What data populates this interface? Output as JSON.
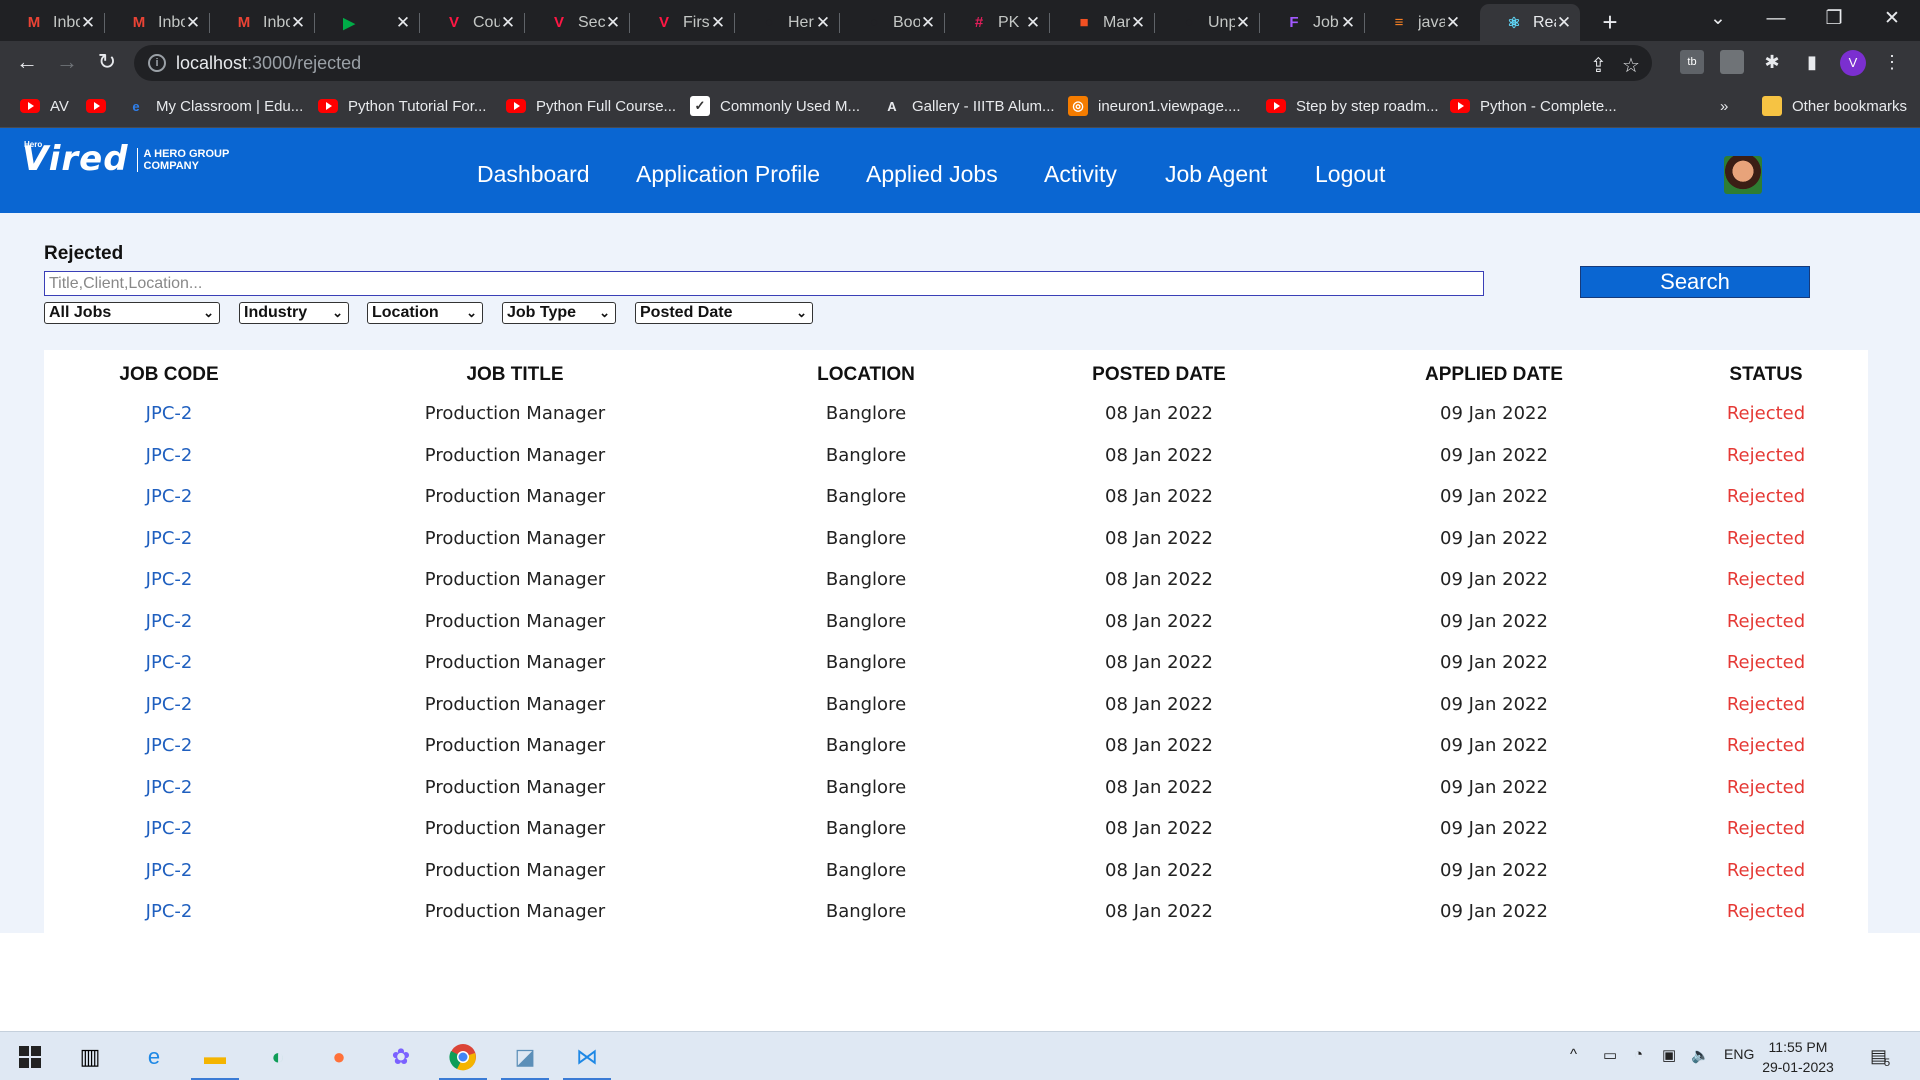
{
  "browser": {
    "tabs": [
      {
        "title": "Inbox",
        "icon": "gmail-icon",
        "color": "#ea4335",
        "glyph": "M"
      },
      {
        "title": "Inbox",
        "icon": "gmail-icon",
        "color": "#ea4335",
        "glyph": "M"
      },
      {
        "title": "Inbox",
        "icon": "gmail-icon",
        "color": "#ea4335",
        "glyph": "M"
      },
      {
        "title": "",
        "icon": "meet-icon",
        "color": "#00ac47",
        "glyph": "▶"
      },
      {
        "title": "Cou",
        "icon": "vired-icon",
        "color": "#ff1744",
        "glyph": "V"
      },
      {
        "title": "Sec",
        "icon": "vired-icon",
        "color": "#ff1744",
        "glyph": "V"
      },
      {
        "title": "First",
        "icon": "vired-icon",
        "color": "#ff1744",
        "glyph": "V"
      },
      {
        "title": "Her",
        "icon": "github-icon",
        "color": "#202124",
        "glyph": "○"
      },
      {
        "title": "Boo",
        "icon": "github-icon",
        "color": "#202124",
        "glyph": "○"
      },
      {
        "title": "PK",
        "icon": "slack-icon",
        "color": "#e01e5a",
        "glyph": "#"
      },
      {
        "title": "Mar",
        "icon": "microsoft-icon",
        "color": "#f25022",
        "glyph": "■"
      },
      {
        "title": "Unp",
        "icon": "github-icon",
        "color": "#202124",
        "glyph": "○"
      },
      {
        "title": "Job",
        "icon": "figma-icon",
        "color": "#a259ff",
        "glyph": "F"
      },
      {
        "title": "java",
        "icon": "stackoverflow-icon",
        "color": "#f48024",
        "glyph": "≡"
      },
      {
        "title": "Rea",
        "icon": "react-icon",
        "color": "#61dafb",
        "glyph": "⚛"
      }
    ],
    "url_host": "localhost",
    "url_path": ":3000/rejected",
    "profile_initial": "V",
    "bookmarks": [
      {
        "label": "AV",
        "type": "yt"
      },
      {
        "label": "",
        "type": "yt"
      },
      {
        "label": "My Classroom | Edu...",
        "type": "edu"
      },
      {
        "label": "Python Tutorial For...",
        "type": "yt"
      },
      {
        "label": "Python Full Course...",
        "type": "yt"
      },
      {
        "label": "Commonly Used M...",
        "type": "doc"
      },
      {
        "label": "Gallery - IIITB Alum...",
        "type": "alum"
      },
      {
        "label": "ineuron1.viewpage....",
        "type": "ineuron"
      },
      {
        "label": "Step by step roadm...",
        "type": "yt"
      },
      {
        "label": "Python - Complete...",
        "type": "yt"
      }
    ],
    "more_bookmarks": "»",
    "other_bookmarks": "Other bookmarks"
  },
  "app": {
    "logo_hero": "Hero",
    "logo_brand": "Vired",
    "logo_tag_line1": "A HERO GROUP",
    "logo_tag_line2": "COMPANY",
    "nav": [
      "Dashboard",
      "Application Profile",
      "Applied Jobs",
      "Activity",
      "Job Agent",
      "Logout"
    ]
  },
  "page": {
    "title": "Rejected",
    "search_placeholder": "Title,Client,Location...",
    "search_button": "Search",
    "filters": [
      "All Jobs",
      "Industry",
      "Location",
      "Job Type",
      "Posted Date"
    ]
  },
  "table": {
    "headers": [
      "JOB CODE",
      "JOB TITLE",
      "LOCATION",
      "POSTED DATE",
      "APPLIED DATE",
      "STATUS"
    ],
    "rows": [
      [
        "JPC-2",
        "Production Manager",
        "Banglore",
        "08 Jan 2022",
        "09 Jan 2022",
        "Rejected"
      ],
      [
        "JPC-2",
        "Production Manager",
        "Banglore",
        "08 Jan 2022",
        "09 Jan 2022",
        "Rejected"
      ],
      [
        "JPC-2",
        "Production Manager",
        "Banglore",
        "08 Jan 2022",
        "09 Jan 2022",
        "Rejected"
      ],
      [
        "JPC-2",
        "Production Manager",
        "Banglore",
        "08 Jan 2022",
        "09 Jan 2022",
        "Rejected"
      ],
      [
        "JPC-2",
        "Production Manager",
        "Banglore",
        "08 Jan 2022",
        "09 Jan 2022",
        "Rejected"
      ],
      [
        "JPC-2",
        "Production Manager",
        "Banglore",
        "08 Jan 2022",
        "09 Jan 2022",
        "Rejected"
      ],
      [
        "JPC-2",
        "Production Manager",
        "Banglore",
        "08 Jan 2022",
        "09 Jan 2022",
        "Rejected"
      ],
      [
        "JPC-2",
        "Production Manager",
        "Banglore",
        "08 Jan 2022",
        "09 Jan 2022",
        "Rejected"
      ],
      [
        "JPC-2",
        "Production Manager",
        "Banglore",
        "08 Jan 2022",
        "09 Jan 2022",
        "Rejected"
      ],
      [
        "JPC-2",
        "Production Manager",
        "Banglore",
        "08 Jan 2022",
        "09 Jan 2022",
        "Rejected"
      ],
      [
        "JPC-2",
        "Production Manager",
        "Banglore",
        "08 Jan 2022",
        "09 Jan 2022",
        "Rejected"
      ],
      [
        "JPC-2",
        "Production Manager",
        "Banglore",
        "08 Jan 2022",
        "09 Jan 2022",
        "Rejected"
      ],
      [
        "JPC-2",
        "Production Manager",
        "Banglore",
        "08 Jan 2022",
        "09 Jan 2022",
        "Rejected"
      ]
    ]
  },
  "colors": {
    "brand_blue": "#0a66d2",
    "code_link": "#1f5fbf",
    "rejected_red": "#e53935",
    "page_bg": "#eef3fb"
  },
  "taskbar": {
    "apps": [
      "windows-start-icon",
      "task-view-icon",
      "internet-explorer-icon",
      "file-explorer-icon",
      "edge-icon",
      "firefox-icon",
      "copilot-icon",
      "chrome-icon",
      "app-icon",
      "vscode-icon"
    ],
    "language": "ENG",
    "time": "11:55 PM",
    "date": "29-01-2023",
    "notification_count": "5"
  }
}
